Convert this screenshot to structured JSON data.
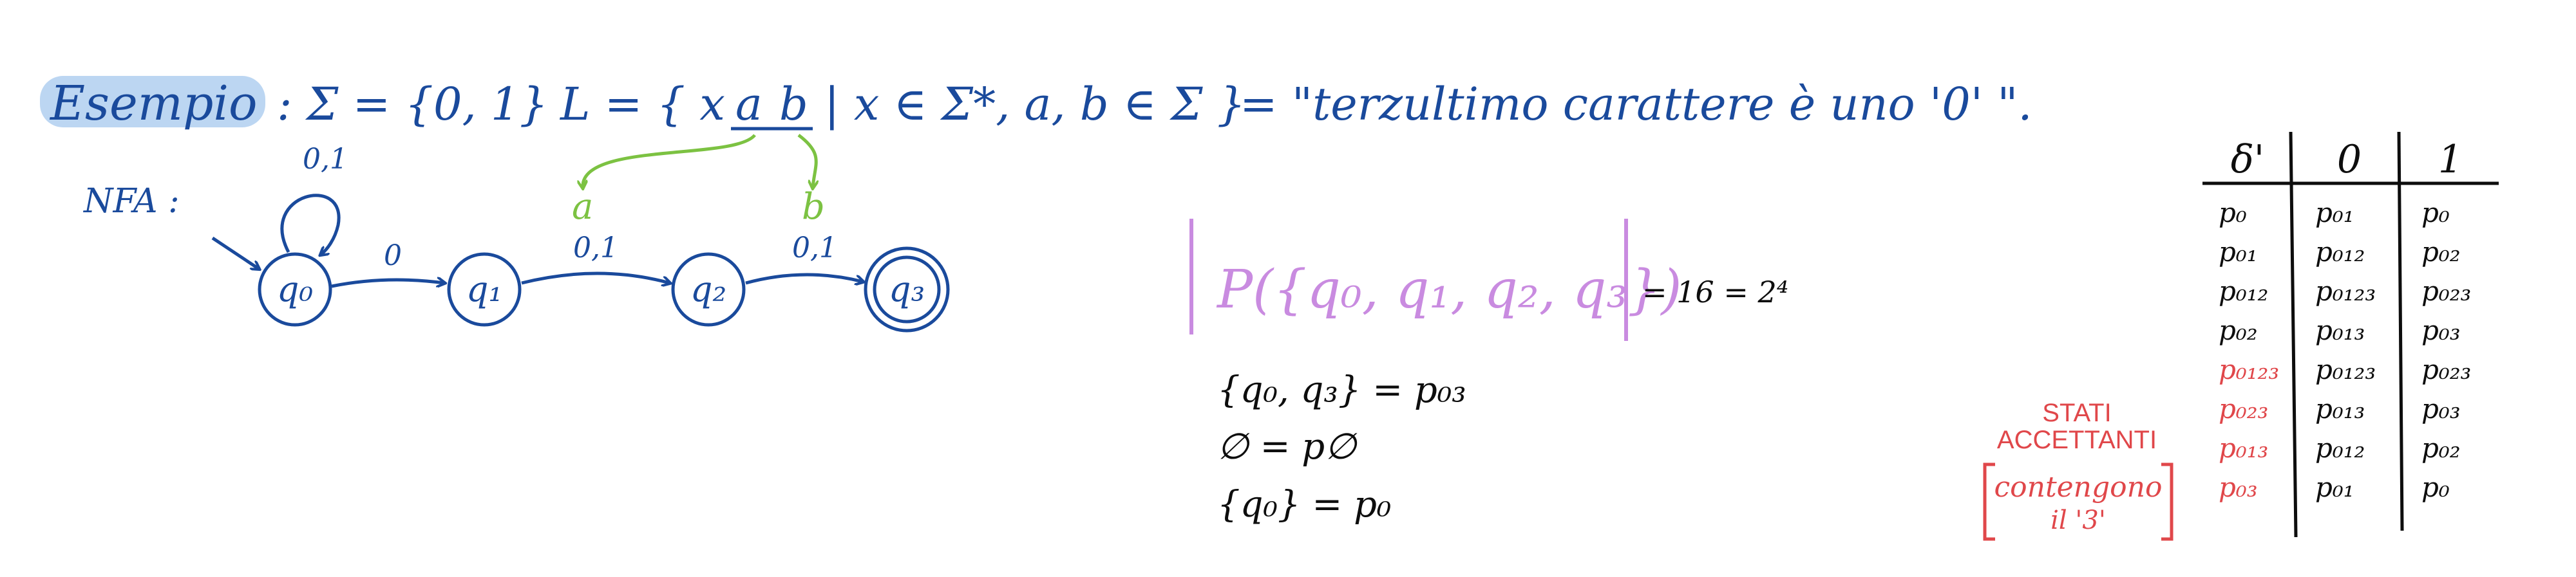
{
  "colors": {
    "blue": "#1a4a9c",
    "green": "#7cc242",
    "purple": "#c98be0",
    "red": "#e0474a",
    "black": "#0d0d0d",
    "highlight": "#bcd6f2"
  },
  "header": {
    "title": "Esempio",
    "alphabet": ": Σ = {0, 1}",
    "language_prefix": "L = { x",
    "language_a": "a",
    "language_b": "b",
    "language_suffix": "| x ∈ Σ*, a, b ∈ Σ }",
    "description": "= \"terzultimo carattere è uno '0' \"."
  },
  "nfa": {
    "label": "NFA :",
    "states": [
      {
        "id": "q0",
        "label": "q₀",
        "accepting": false
      },
      {
        "id": "q1",
        "label": "q₁",
        "accepting": false
      },
      {
        "id": "q2",
        "label": "q₂",
        "accepting": false
      },
      {
        "id": "q3",
        "label": "q₃",
        "accepting": true
      }
    ],
    "transitions": [
      {
        "from": "q0",
        "to": "q0",
        "label": "0,1"
      },
      {
        "from": "q0",
        "to": "q1",
        "label": "0"
      },
      {
        "from": "q1",
        "to": "q2",
        "label": "0,1"
      },
      {
        "from": "q2",
        "to": "q3",
        "label": "0,1"
      }
    ],
    "annotations": {
      "a": "a",
      "b": "b"
    }
  },
  "powerset": {
    "expression": "P({q₀, q₁, q₂, q₃})",
    "result": "= 16 = 2⁴"
  },
  "notes": [
    "{q₀, q₃} = p₀₃",
    "∅ = p∅",
    "{q₀} = p₀"
  ],
  "table": {
    "headers": [
      "δ'",
      "0",
      "1"
    ],
    "rows": [
      {
        "state": "p₀",
        "on0": "p₀₁",
        "on1": "p₀",
        "accepting": false
      },
      {
        "state": "p₀₁",
        "on0": "p₀₁₂",
        "on1": "p₀₂",
        "accepting": false
      },
      {
        "state": "p₀₁₂",
        "on0": "p₀₁₂₃",
        "on1": "p₀₂₃",
        "accepting": false
      },
      {
        "state": "p₀₂",
        "on0": "p₀₁₃",
        "on1": "p₀₃",
        "accepting": false
      },
      {
        "state": "p₀₁₂₃",
        "on0": "p₀₁₂₃",
        "on1": "p₀₂₃",
        "accepting": true
      },
      {
        "state": "p₀₂₃",
        "on0": "p₀₁₃",
        "on1": "p₀₃",
        "accepting": true
      },
      {
        "state": "p₀₁₃",
        "on0": "p₀₁₂",
        "on1": "p₀₂",
        "accepting": true
      },
      {
        "state": "p₀₃",
        "on0": "p₀₁",
        "on1": "p₀",
        "accepting": true
      }
    ]
  },
  "accepting_note": {
    "title_line1": "STATI",
    "title_line2": "ACCETTANTI",
    "body_line1": "contengono",
    "body_line2": "il '3'"
  }
}
